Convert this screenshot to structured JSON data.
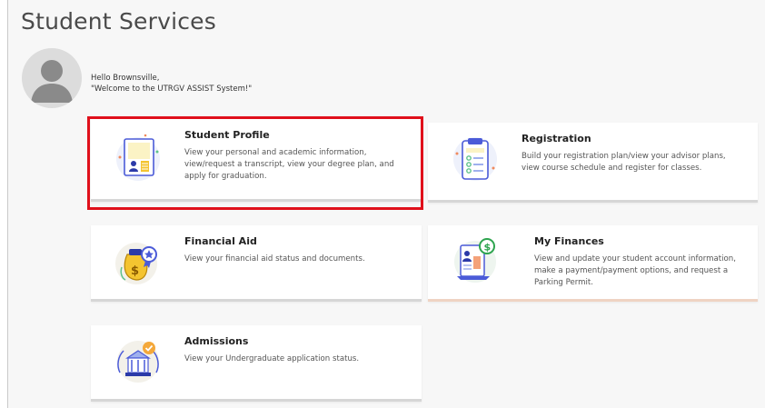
{
  "page": {
    "title": "Student Services",
    "greeting_line1": "Hello Brownsville,",
    "greeting_line2": "\"Welcome to the UTRGV ASSIST System!\""
  },
  "cards": [
    {
      "title": "Student Profile",
      "description": "View your personal and academic information, view/request a transcript, view your degree plan, and apply for graduation.",
      "icon": "student-profile-icon",
      "highlighted": true
    },
    {
      "title": "Registration",
      "description": "Build your registration plan/view your advisor plans, view course schedule and register for classes.",
      "icon": "registration-clipboard-icon"
    },
    {
      "title": "Financial Aid",
      "description": "View your financial aid status and documents.",
      "icon": "money-bag-icon"
    },
    {
      "title": "My Finances",
      "description": "View and update your student account information, make a payment/payment options, and request a Parking Permit.",
      "icon": "finances-document-icon"
    },
    {
      "title": "Admissions",
      "description": "View your Undergraduate application status.",
      "icon": "admissions-building-icon"
    }
  ],
  "colors": {
    "highlight": "#e0101b",
    "card_bar": "#d6d6d6",
    "finances_bar": "#efd3c3",
    "background": "#f7f7f7"
  }
}
